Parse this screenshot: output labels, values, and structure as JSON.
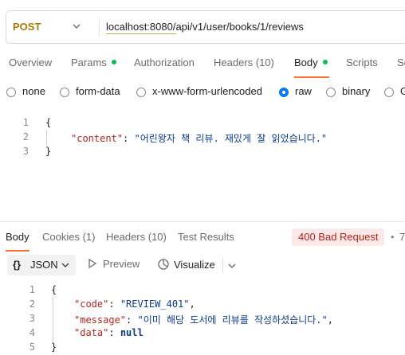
{
  "request": {
    "method": "POST",
    "url": "localhost:8080/api/v1/user/books/1/reviews"
  },
  "request_tabs": [
    {
      "label": "Overview"
    },
    {
      "label": "Params"
    },
    {
      "label": "Authorization"
    },
    {
      "label": "Headers (10)"
    },
    {
      "label": "Body"
    },
    {
      "label": "Scripts"
    },
    {
      "label": "Se"
    }
  ],
  "body_types": [
    {
      "label": "none"
    },
    {
      "label": "form-data"
    },
    {
      "label": "x-www-form-urlencoded"
    },
    {
      "label": "raw",
      "selected": true
    },
    {
      "label": "binary"
    },
    {
      "label": "G"
    }
  ],
  "request_body": {
    "line_numbers": [
      "1",
      "2",
      "3"
    ],
    "open_brace": "{",
    "key": "\"content\"",
    "colon": ": ",
    "value": "\"어린왕자 책 리뷰. 재밌게 잘 읽었습니다.\"",
    "close_brace": "}"
  },
  "response_tabs": [
    {
      "label": "Body"
    },
    {
      "label": "Cookies (1)"
    },
    {
      "label": "Headers (10)"
    },
    {
      "label": "Test Results"
    }
  ],
  "response_status": "400 Bad Request",
  "response_extra": "7",
  "response_toolbar": {
    "format_icon": "{}",
    "format_label": "JSON",
    "preview_label": "Preview",
    "visualize_label": "Visualize"
  },
  "response_body": {
    "line_numbers": [
      "1",
      "2",
      "3",
      "4",
      "5"
    ],
    "open_brace": "{",
    "code_key": "\"code\"",
    "code_value": "\"REVIEW_401\"",
    "message_key": "\"message\"",
    "message_value": "\"이미 해당 도서에 리뷰를 작성하셨습니다.\"",
    "data_key": "\"data\"",
    "data_value": "null",
    "colon": ": ",
    "comma": ",",
    "close_brace": "}"
  },
  "colors": {
    "accent": "#ff6c37",
    "method": "#ad7a03",
    "status_bg": "#fde9e9",
    "status_text": "#b42318",
    "radio_selected": "#097bed",
    "dot": "#0cbb52"
  }
}
